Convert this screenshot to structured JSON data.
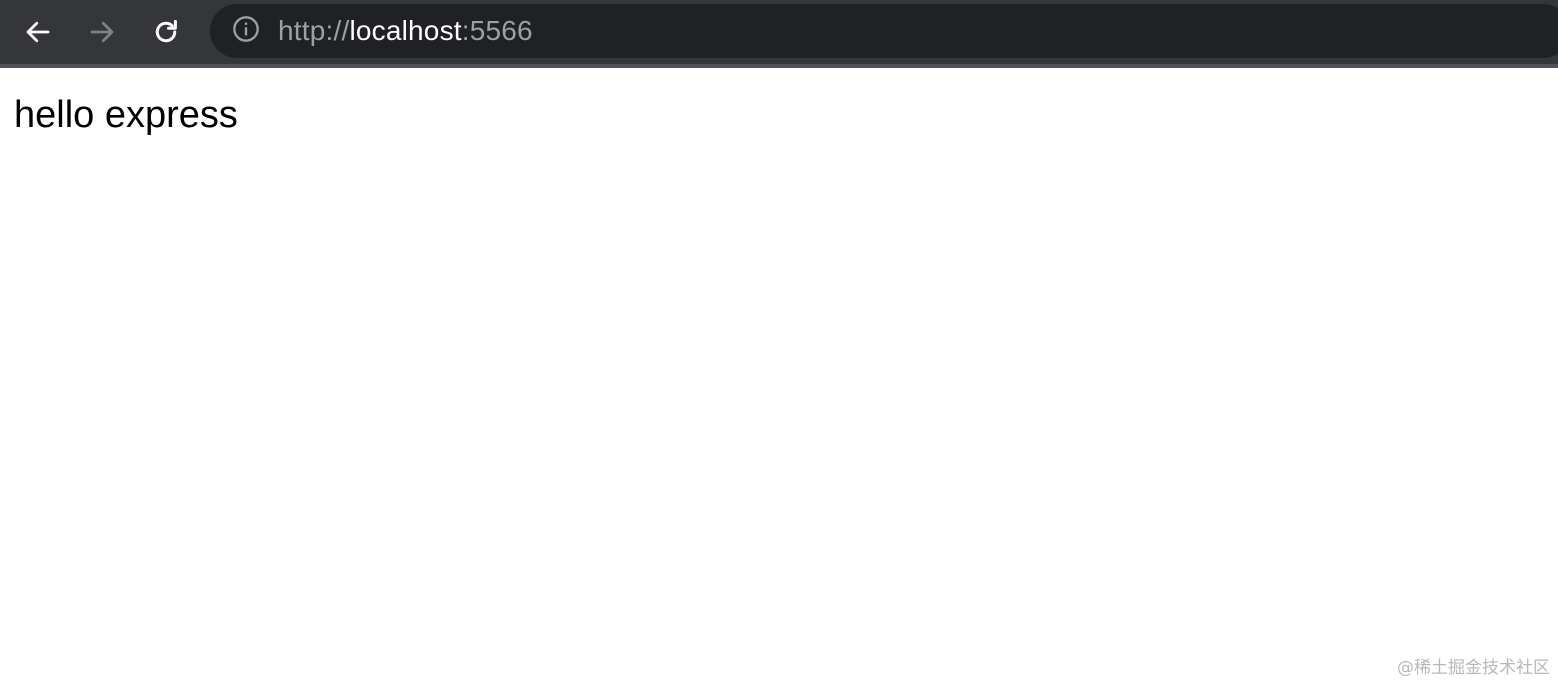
{
  "browser": {
    "url_scheme": "http://",
    "url_host": "localhost",
    "url_port": ":5566",
    "icons": {
      "back": "back-arrow-icon",
      "forward": "forward-arrow-icon",
      "reload": "reload-icon",
      "site_info": "info-icon"
    },
    "colors": {
      "toolbar": "#35363a",
      "omnibox": "#202124",
      "url_dim": "#9aa0a6",
      "url_host": "#ffffff"
    }
  },
  "page": {
    "body_text": "hello express"
  },
  "watermark": {
    "text": "@稀土掘金技术社区"
  }
}
